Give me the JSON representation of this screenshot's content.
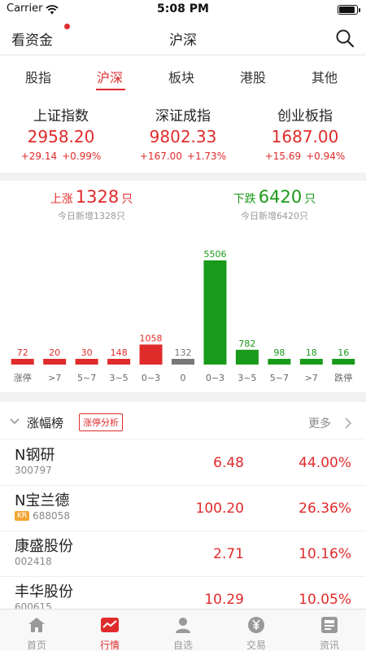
{
  "status_bar": {
    "carrier": "Carrier",
    "time": "5:08 PM",
    "battery_level": 0.9
  },
  "navbar": {
    "left_link": "看资金",
    "title": "沪深"
  },
  "tabs": [
    {
      "label": "股指",
      "active": false
    },
    {
      "label": "沪深",
      "active": true
    },
    {
      "label": "板块",
      "active": false
    },
    {
      "label": "港股",
      "active": false
    },
    {
      "label": "其他",
      "active": false
    }
  ],
  "indices": [
    {
      "name": "上证指数",
      "value": "2958.20",
      "change": "+29.14",
      "percent": "+0.99%"
    },
    {
      "name": "深证成指",
      "value": "9802.33",
      "change": "+167.00",
      "percent": "+1.73%"
    },
    {
      "name": "创业板指",
      "value": "1687.00",
      "change": "+15.69",
      "percent": "+0.94%"
    }
  ],
  "summary": {
    "up": {
      "label": "上涨",
      "count": "1328",
      "unit": "只",
      "sub": "今日新增1328只"
    },
    "down": {
      "label": "下跌",
      "count": "6420",
      "unit": "只",
      "sub": "今日新增6420只"
    }
  },
  "chart_data": {
    "type": "bar",
    "categories": [
      "涨停",
      ">7",
      "5~7",
      "3~5",
      "0~3",
      "0",
      "0~3",
      "3~5",
      "5~7",
      ">7",
      "跌停"
    ],
    "values": [
      72,
      20,
      30,
      148,
      1058,
      132,
      5506,
      782,
      98,
      18,
      16
    ],
    "colors": [
      "#e02b2b",
      "#e02b2b",
      "#e02b2b",
      "#e02b2b",
      "#e02b2b",
      "#777777",
      "#1a9a1a",
      "#1a9a1a",
      "#1a9a1a",
      "#1a9a1a",
      "#1a9a1a"
    ],
    "title": "",
    "xlabel": "",
    "ylabel": ""
  },
  "ranking": {
    "title": "涨幅榜",
    "badge": "涨停分析",
    "more": "更多",
    "rows": [
      {
        "name": "N钢研",
        "code": "300797",
        "tag": "",
        "price": "6.48",
        "percent": "44.00%"
      },
      {
        "name": "N宝兰德",
        "code": "688058",
        "tag": "KR",
        "price": "100.20",
        "percent": "26.36%"
      },
      {
        "name": "康盛股份",
        "code": "002418",
        "tag": "",
        "price": "2.71",
        "percent": "10.16%"
      },
      {
        "name": "丰华股份",
        "code": "600615",
        "tag": "",
        "price": "10.29",
        "percent": "10.05%"
      }
    ]
  },
  "tabbar": [
    {
      "label": "首页",
      "icon": "home-icon",
      "active": false
    },
    {
      "label": "行情",
      "icon": "market-chart-icon",
      "active": true
    },
    {
      "label": "自选",
      "icon": "person-icon",
      "active": false
    },
    {
      "label": "交易",
      "icon": "yuan-coin-icon",
      "active": false
    },
    {
      "label": "资讯",
      "icon": "news-icon",
      "active": false
    }
  ],
  "colors": {
    "up": "#e02b2b",
    "down": "#1a9a1a",
    "flat": "#777777"
  }
}
